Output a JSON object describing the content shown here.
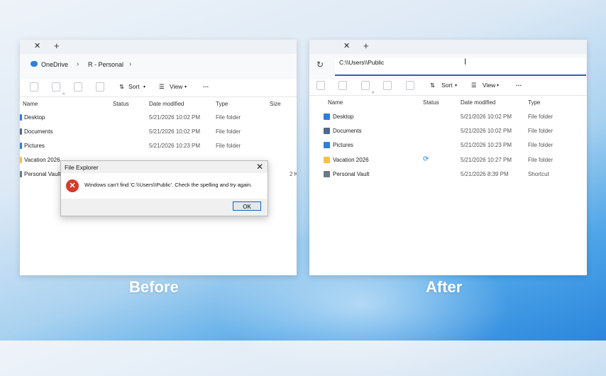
{
  "captions": {
    "before": "Before",
    "after": "After"
  },
  "before": {
    "breadcrumb": [
      "OneDrive",
      "R - Personal"
    ],
    "toolbar": {
      "sort": "Sort",
      "view": "View",
      "more": "···"
    },
    "columns": {
      "name": "Name",
      "status": "Status",
      "date": "Date modified",
      "type": "Type",
      "size": "Size"
    },
    "rows": [
      {
        "name": "Desktop",
        "date": "5/21/2026 10:02 PM",
        "type": "File folder",
        "size": ""
      },
      {
        "name": "Documents",
        "date": "5/21/2026 10:02 PM",
        "type": "File folder",
        "size": ""
      },
      {
        "name": "Pictures",
        "date": "5/21/2026 10:23 PM",
        "type": "File folder",
        "size": ""
      },
      {
        "name": "Vacation 2026",
        "date": "",
        "type": "",
        "size": ""
      },
      {
        "name": "Personal Vault",
        "date": "",
        "type": "",
        "size": "2 K"
      }
    ],
    "dialog": {
      "title": "File Explorer",
      "message": "Windows can't find 'C:\\\\Users\\\\Public'. Check the spelling and try again.",
      "ok": "OK"
    }
  },
  "after": {
    "address_value": "C:\\\\Users\\\\Public",
    "toolbar": {
      "sort": "Sort",
      "view": "View",
      "more": "···"
    },
    "columns": {
      "name": "Name",
      "status": "Status",
      "date": "Date modified",
      "type": "Type"
    },
    "rows": [
      {
        "name": "Desktop",
        "date": "5/21/2026 10:02 PM",
        "type": "File folder"
      },
      {
        "name": "Documents",
        "date": "5/21/2026 10:02 PM",
        "type": "File folder"
      },
      {
        "name": "Pictures",
        "date": "5/21/2026 10:23 PM",
        "type": "File folder"
      },
      {
        "name": "Vacation 2026",
        "date": "5/21/2026 10:27 PM",
        "type": "File folder"
      },
      {
        "name": "Personal Vault",
        "date": "5/21/2026 8:39 PM",
        "type": "Shortcut"
      }
    ]
  },
  "colors": {
    "accent": "#1f66c2",
    "error": "#d43a2a",
    "folder_blue": "#2f7fd6",
    "folder_yellow": "#f2c14b"
  }
}
